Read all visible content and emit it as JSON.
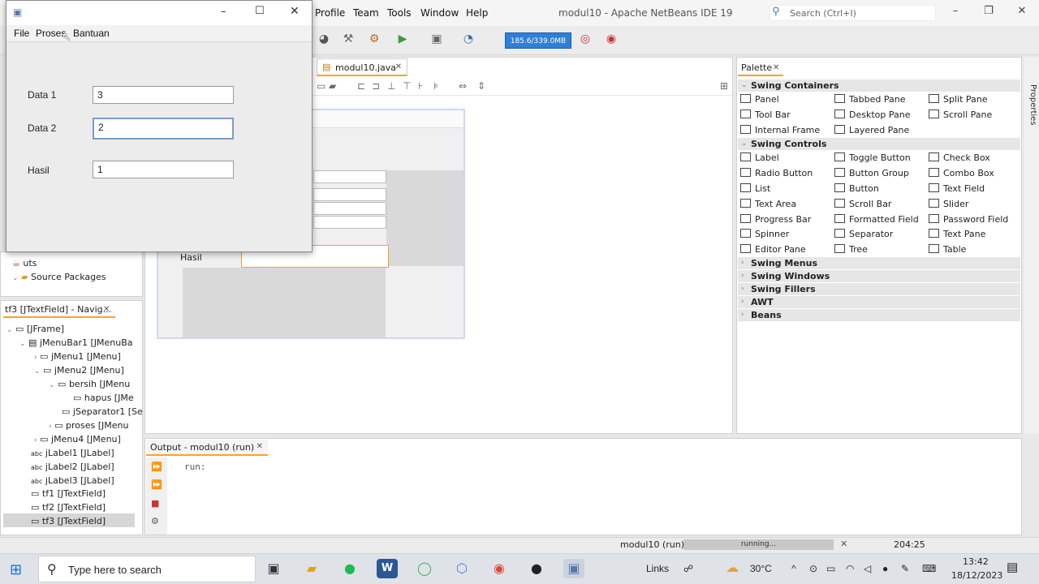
{
  "ide": {
    "window_title": "modul10 - Apache NetBeans IDE 19",
    "menus": [
      "Profile",
      "Team",
      "Tools",
      "Window",
      "Help"
    ],
    "search_placeholder": "Search (Ctrl+I)",
    "memory": "185.6/339.0MB",
    "editor_tab": "modul10.java"
  },
  "design_preview": {
    "label_hasil": "Hasil"
  },
  "projects_tree": {
    "items": [
      "uts",
      "Source Packages"
    ]
  },
  "navigator": {
    "tab_label": "tf3 [JTextField] - Navig...",
    "items": [
      "[JFrame]",
      "jMenuBar1 [JMenuBa",
      "jMenu1 [JMenu]",
      "jMenu2 [JMenu]",
      "bersih [JMenu",
      "hapus [JMe",
      "jSeparator1 [Se",
      "proses [JMenu",
      "jMenu4 [JMenu]",
      "jLabel1 [JLabel]",
      "jLabel2 [JLabel]",
      "jLabel3 [JLabel]",
      "tf1 [JTextField]",
      "tf2 [JTextField]",
      "tf3 [JTextField]"
    ]
  },
  "palette": {
    "tab_label": "Palette",
    "categories": {
      "swing_containers": "Swing Containers",
      "swing_controls": "Swing Controls",
      "swing_menus": "Swing Menus",
      "swing_windows": "Swing Windows",
      "swing_fillers": "Swing Fillers",
      "awt": "AWT",
      "beans": "Beans"
    },
    "containers": [
      "Panel",
      "Tabbed Pane",
      "Split Pane",
      "Tool Bar",
      "Desktop Pane",
      "Scroll Pane",
      "Internal Frame",
      "Layered Pane"
    ],
    "controls": [
      "Label",
      "Toggle Button",
      "Check Box",
      "Radio Button",
      "Button Group",
      "Combo Box",
      "List",
      "Button",
      "Text Field",
      "Text Area",
      "Scroll Bar",
      "Slider",
      "Progress Bar",
      "Formatted Field",
      "Password Field",
      "Spinner",
      "Separator",
      "Text Pane",
      "Editor Pane",
      "Tree",
      "Table"
    ]
  },
  "properties_label": "Properties",
  "output": {
    "tab_label": "Output - modul10 (run)",
    "text": "run:"
  },
  "status": {
    "project": "modul10 (run)",
    "progress_text": "running...",
    "position": "204:25"
  },
  "app": {
    "menus": [
      "File",
      "Proses",
      "Bantuan"
    ],
    "label1": "Data 1",
    "label2": "Data 2",
    "label3": "Hasil",
    "value1": "3",
    "value2": "2",
    "value3": "1"
  },
  "taskbar": {
    "search_placeholder": "Type here to search",
    "links": "Links",
    "temperature": "30°C",
    "time": "13:42",
    "date": "18/12/2023"
  },
  "colors": {
    "accent_tab": "#f5a623",
    "memory_bar": "#2f7fd6",
    "selection_border": "#f0a030"
  }
}
